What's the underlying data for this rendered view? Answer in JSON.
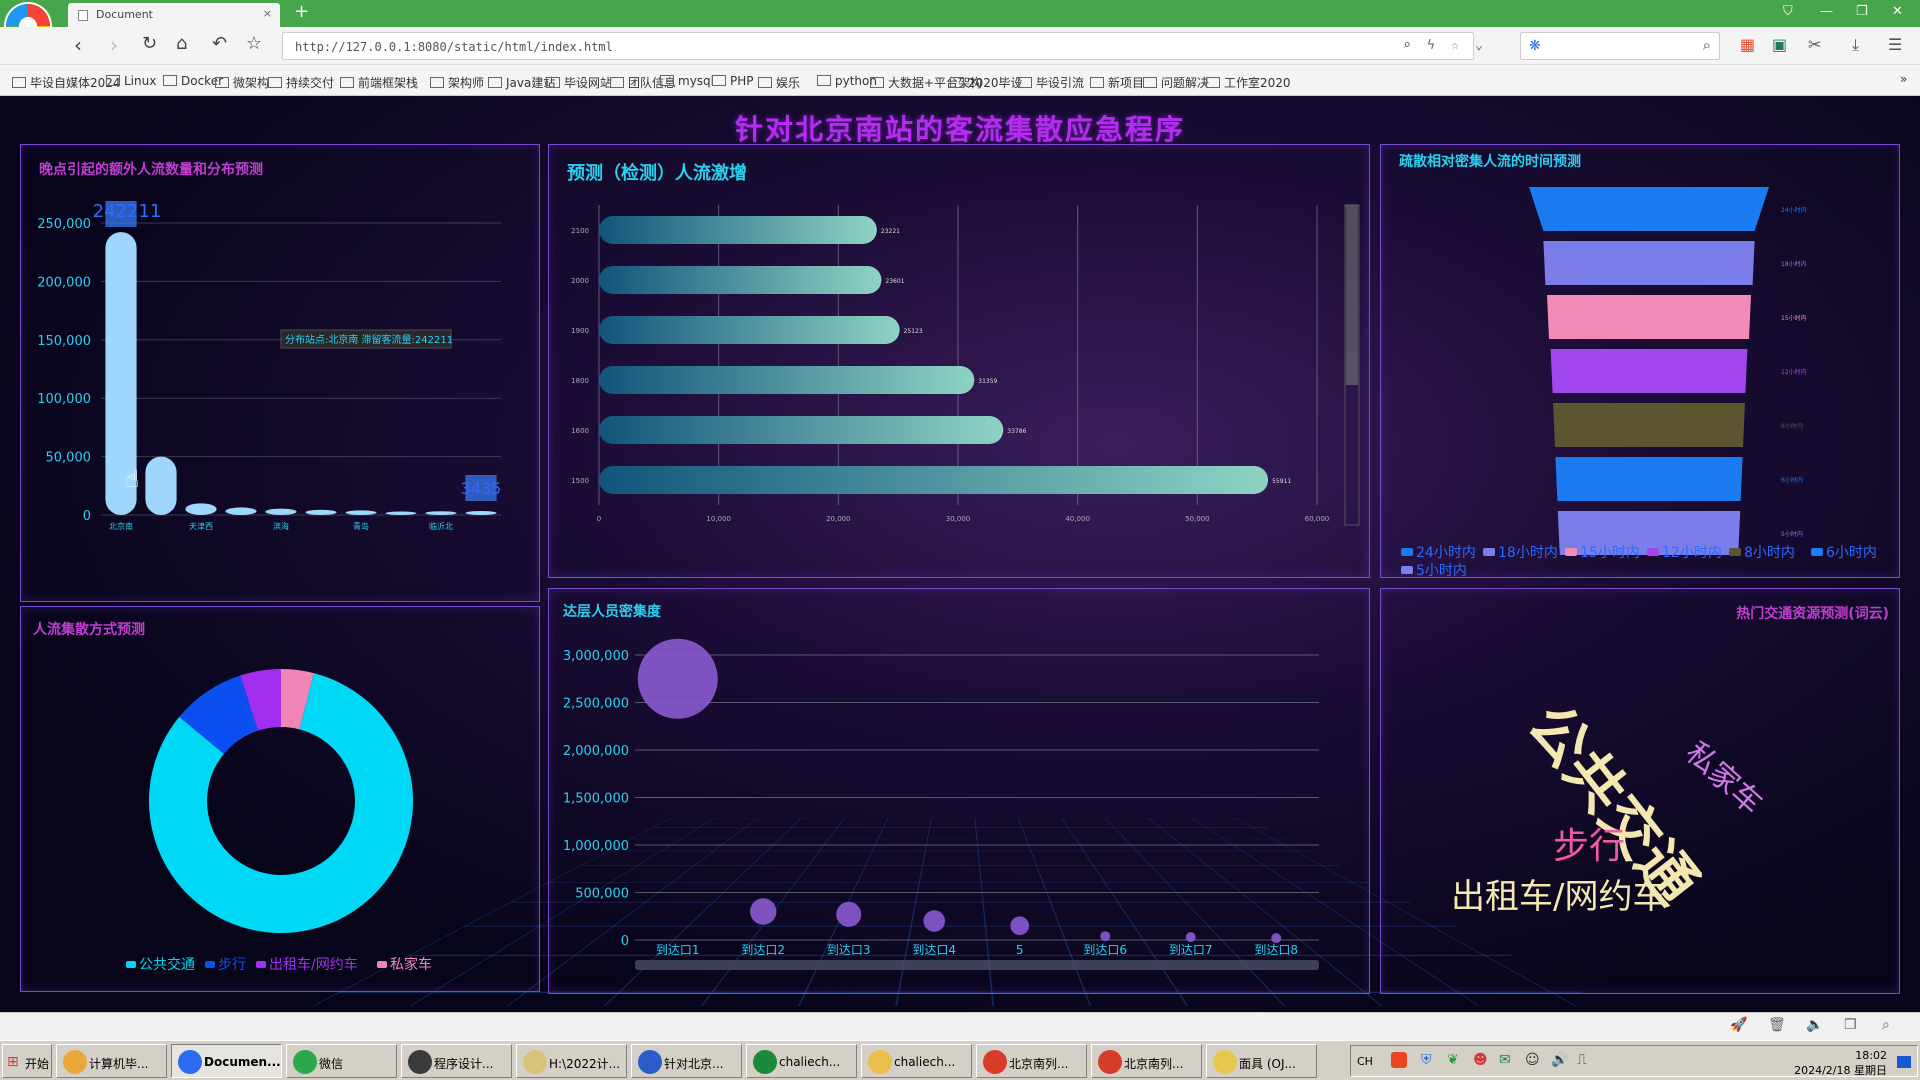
{
  "browser": {
    "tab_title": "Document",
    "url": "http://127.0.0.1:8080/static/html/index.html",
    "bookmarks": [
      "毕设自媒体2024",
      "Linux",
      "Docker",
      "微架构",
      "持续交付",
      "前端框架栈",
      "架构师",
      "Java建站",
      "毕设网站",
      "团队信息",
      "mysql",
      "PHP",
      "娱乐",
      "python",
      "大数据+平台架构",
      "2020毕设",
      "毕设引流",
      "新项目",
      "问题解决",
      "工作室2020"
    ]
  },
  "dashboard": {
    "title": "针对北京南站的客流集散应急程序",
    "panels": {
      "bar": "晚点引起的额外人流数量和分布预测",
      "hbar": "预测（检测）人流激增",
      "funnel": "疏散相对密集人流的时间预测",
      "donut": "人流集散方式预测",
      "bubble": "达层人员密集度",
      "words": "热门交通资源预测(词云)"
    }
  },
  "chart_data": [
    {
      "type": "bar",
      "id": "bar1",
      "categories": [
        "北京南",
        "",
        "天津西",
        "",
        "滨海",
        "",
        "青岛",
        "",
        "临沂北",
        ""
      ],
      "values": [
        242211,
        50000,
        10000,
        6500,
        5500,
        4500,
        4000,
        3000,
        3200,
        3435
      ],
      "ylim": [
        0,
        250000
      ],
      "yticks": [
        "0",
        "50,000",
        "100,000",
        "150,000",
        "200,000",
        "250,000"
      ],
      "max_label": "242211",
      "min_label": "3435",
      "tooltip": "分布站点:北京南 滞留客流量:242211",
      "color": "#9fd6fb",
      "label_color": "#2f6bff"
    },
    {
      "type": "bar",
      "id": "hbar",
      "categories": [
        "1500",
        "1600",
        "1800",
        "1900",
        "2000",
        "2100"
      ],
      "values": [
        55911,
        33786,
        31359,
        25123,
        23601,
        23221
      ],
      "xlim": [
        0,
        60000
      ],
      "xticks": [
        "0",
        "10,000",
        "20,000",
        "30,000",
        "40,000",
        "50,000",
        "60,000"
      ],
      "gradient": [
        "#12547a",
        "#8fd3c4"
      ]
    },
    {
      "type": "funnel",
      "id": "funnel",
      "legend": [
        "24小时内",
        "18小时内",
        "15小时内",
        "12小时内",
        "8小时内",
        "6小时内",
        "5小时内"
      ],
      "colors": [
        "#1a7cf0",
        "#7b7de8",
        "#f28bb6",
        "#a147ed",
        "#5b5630",
        "#1a7cf0",
        "#7b7de8"
      ],
      "values": [
        100,
        88,
        85,
        82,
        80,
        78,
        76
      ]
    },
    {
      "type": "pie",
      "id": "donut",
      "legend": [
        "公共交通",
        "步行",
        "出租车/网约车",
        "私家车"
      ],
      "values": [
        82,
        9,
        5,
        4
      ],
      "colors": [
        "#00d9f5",
        "#0b4ff0",
        "#a22ff0",
        "#f086b6"
      ]
    },
    {
      "type": "scatter",
      "id": "bubble",
      "categories": [
        "到达口1",
        "到达口2",
        "到达口3",
        "到达口4",
        "5",
        "到达口6",
        "到达口7",
        "到达口8"
      ],
      "values": [
        2750000,
        300000,
        270000,
        200000,
        150000,
        40000,
        30000,
        20000
      ],
      "ylim": [
        0,
        3000000
      ],
      "yticks": [
        "0",
        "500,000",
        "1,000,000",
        "1,500,000",
        "2,000,000",
        "2,500,000",
        "3,000,000"
      ]
    },
    {
      "type": "other",
      "id": "words",
      "words": [
        {
          "text": "公共交通",
          "color": "#f4e7b0"
        },
        {
          "text": "私家车",
          "color": "#d07ae8"
        },
        {
          "text": "步行",
          "color": "#f05aa0"
        },
        {
          "text": "出租车/网约车",
          "color": "#f4e7b0"
        }
      ]
    }
  ],
  "taskbar": {
    "start": "开始",
    "items": [
      "计算机毕...",
      "Documen...",
      "微信",
      "程序设计...",
      "H:\\2022计...",
      "针对北京...",
      "chaliech...",
      "chaliech...",
      "北京南列...",
      "北京南列...",
      "面具 (OJ..."
    ],
    "clock": "18:02",
    "date": "2024/2/18 星期日",
    "ime": "CH"
  }
}
